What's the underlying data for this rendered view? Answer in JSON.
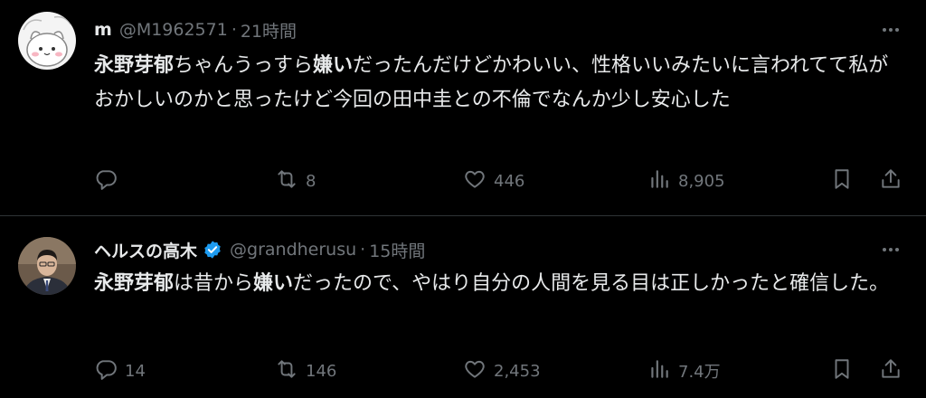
{
  "tweets": [
    {
      "name": "m",
      "handle": "@M1962571",
      "dot": "·",
      "time": "21時間",
      "body": [
        {
          "text": "永野芽郁",
          "bold": true
        },
        {
          "text": "ちゃんうっすら",
          "bold": false
        },
        {
          "text": "嫌い",
          "bold": true
        },
        {
          "text": "だったんだけどかわいい、性格いいみたいに言われてて私がおかしいのかと思ったけど今回の田中圭との不倫でなんか少し安心した",
          "bold": false
        }
      ],
      "replies": "",
      "retweets": "8",
      "likes": "446",
      "views": "8,905",
      "verified": false
    },
    {
      "name": "ヘルスの高木",
      "handle": "@grandherusu",
      "dot": "·",
      "time": "15時間",
      "body": [
        {
          "text": "永野芽郁",
          "bold": true
        },
        {
          "text": "は昔から",
          "bold": false
        },
        {
          "text": "嫌い",
          "bold": true
        },
        {
          "text": "だったので、やはり自分の人間を見る目は正しかったと確信した。",
          "bold": false
        }
      ],
      "replies": "14",
      "retweets": "146",
      "likes": "2,453",
      "views": "7.4万",
      "verified": true
    }
  ],
  "icons": {
    "reply": "reply-icon",
    "retweet": "retweet-icon",
    "like": "heart-icon",
    "views": "views-icon",
    "bookmark": "bookmark-icon",
    "share": "share-icon",
    "more": "more-icon",
    "verified": "verified-badge-icon"
  },
  "colors": {
    "background": "#000000",
    "text": "#e7e9ea",
    "muted": "#71767b",
    "divider": "#2f3336",
    "verified": "#1d9bf0"
  }
}
